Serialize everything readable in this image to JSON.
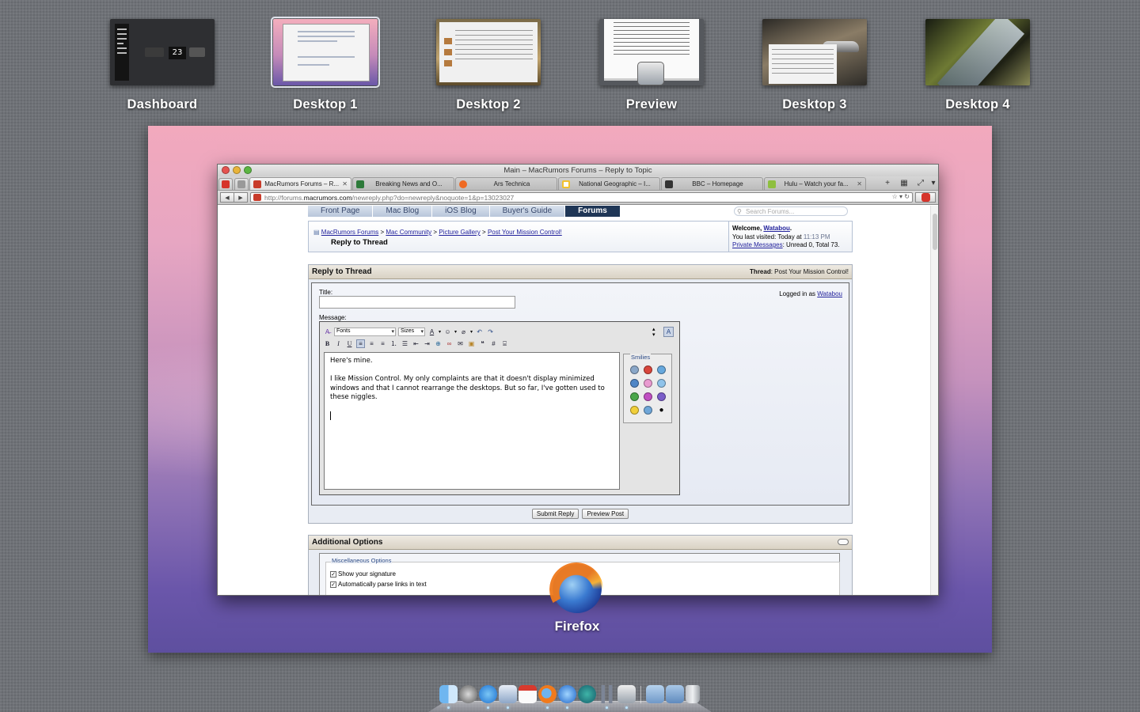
{
  "spaces": [
    {
      "label": "Dashboard",
      "type": "dashboard",
      "widget_date": "23"
    },
    {
      "label": "Desktop 1",
      "type": "desktop",
      "active": true
    },
    {
      "label": "Desktop 2",
      "type": "desktop"
    },
    {
      "label": "Preview",
      "type": "app"
    },
    {
      "label": "Desktop 3",
      "type": "desktop"
    },
    {
      "label": "Desktop 4",
      "type": "desktop"
    }
  ],
  "browser": {
    "window_title": "Main – MacRumors Forums – Reply to Topic",
    "tabs": [
      {
        "title": "MacRumors Forums – R...",
        "active": true,
        "favicon_color": "#c83b2a"
      },
      {
        "title": "Breaking News and O...",
        "favicon_color": "#2d7a3a"
      },
      {
        "title": "Ars Technica",
        "favicon_color": "#ef6a23"
      },
      {
        "title": "National Geographic – I...",
        "favicon_color": "#f2c12e"
      },
      {
        "title": "BBC – Homepage",
        "favicon_color": "#333333"
      },
      {
        "title": "Hulu – Watch your fa...",
        "favicon_color": "#8ebf3f"
      }
    ],
    "url_prefix": "http://forums.",
    "url_host": "macrumors.com",
    "url_path": "/newreply.php?do=newreply&noquote=1&p=13023027"
  },
  "page": {
    "nav": [
      "Front Page",
      "Mac Blog",
      "iOS Blog",
      "Buyer's Guide",
      "Forums"
    ],
    "nav_active": "Forums",
    "search_placeholder": "Search Forums...",
    "breadcrumb": {
      "items": [
        "MacRumors Forums",
        "Mac Community",
        "Picture Gallery",
        "Post Your Mission Control!"
      ],
      "separator": ">",
      "current": "Reply to Thread"
    },
    "welcome": {
      "prefix": "Welcome, ",
      "user": "Watabou",
      "suffix": ".",
      "last_visit_label": "You last visited: Today at ",
      "last_visit_time": "11:13 PM",
      "pm_link": "Private Messages",
      "pm_stats": ": Unread 0, Total 73."
    },
    "reply": {
      "header": "Reply to Thread",
      "thread_label": "Thread",
      "thread_name": ": Post Your Mission Control!",
      "title_label": "Title:",
      "message_label": "Message:",
      "logged_in_prefix": "Logged in as ",
      "logged_in_user": "Watabou",
      "font_select": "Fonts",
      "size_select": "Sizes",
      "message_lines": [
        "Here's mine.",
        "I like Mission Control. My only complaints are that it doesn't display minimized windows and that I cannot rearrange the desktops. But so far, I've gotten used to these niggles."
      ],
      "smilies_label": "Smilies",
      "submit_button": "Submit Reply",
      "preview_button": "Preview Post"
    },
    "options": {
      "header": "Additional Options",
      "group_label": "Miscellaneous Options",
      "checkboxes": [
        {
          "label": "Show your signature",
          "checked": true
        },
        {
          "label": "Automatically parse links in text",
          "checked": true
        }
      ]
    }
  },
  "active_app": {
    "name": "Firefox",
    "icon": "firefox-icon"
  },
  "dock_icons": [
    "finder-icon",
    "launchpad-icon",
    "app-store-icon",
    "mail-icon",
    "ical-icon",
    "firefox-icon",
    "itunes-icon",
    "time-machine-icon",
    "parallels-icon",
    "preview-icon",
    "applications-folder-icon",
    "downloads-folder-icon",
    "trash-icon"
  ]
}
